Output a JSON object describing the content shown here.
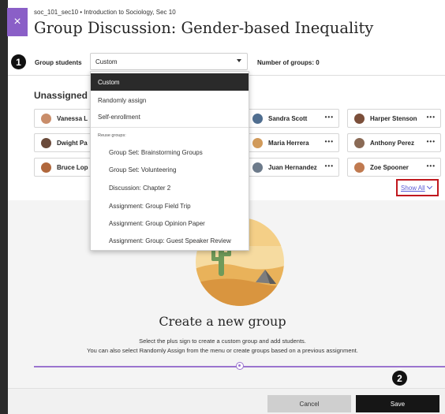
{
  "window": {
    "close_glyph": "×"
  },
  "header": {
    "course": "soc_101_sec10 • Introduction to Sociology, Sec 10",
    "title": "Group Discussion: Gender-based Inequality"
  },
  "steps": {
    "one": "1",
    "two": "2"
  },
  "group_students": {
    "label": "Group students",
    "selected": "Custom",
    "number_of_groups": "Number of groups: 0"
  },
  "unassigned": {
    "heading": "Unassigned s",
    "students": [
      {
        "name": "Vanessa L",
        "avatar_color": "#c98d6a"
      },
      {
        "name": "Dwight Pa",
        "avatar_color": "#6a4a3a"
      },
      {
        "name": "Bruce Lop",
        "avatar_color": "#b0673c"
      },
      {
        "name": "Sandra Scott",
        "avatar_color": "#4f6d8f"
      },
      {
        "name": "Maria Herrera",
        "avatar_color": "#d19a5a"
      },
      {
        "name": "Juan Hernandez",
        "avatar_color": "#6c7a8a"
      },
      {
        "name": "Harper Stenson",
        "avatar_color": "#7b4f3a"
      },
      {
        "name": "Anthony Perez",
        "avatar_color": "#8a6a55"
      },
      {
        "name": "Zoe Spooner",
        "avatar_color": "#c07a50"
      }
    ],
    "more_glyph": "•••",
    "show_all": "Show All"
  },
  "dropdown": {
    "options": [
      "Custom",
      "Randomly assign",
      "Self-enrollment"
    ],
    "reuse_label": "Reuse groups:",
    "reuse_options": [
      "Group Set: Brainstorming Groups",
      "Group Set: Volunteering",
      "Discussion: Chapter 2",
      "Assignment: Group Field Trip",
      "Assignment: Group Opinion Paper",
      "Assignment: Group: Guest Speaker Review"
    ]
  },
  "create": {
    "title": "Create a new group",
    "line1": "Select the plus sign to create a custom group and add students.",
    "line2": "You can also select Randomly Assign from the menu or create groups based on a previous assignment."
  },
  "footer": {
    "cancel": "Cancel",
    "save": "Save"
  },
  "colors": {
    "accent": "#8a5fc7",
    "highlight_border": "#c0181e",
    "link": "#5b5bd6"
  }
}
